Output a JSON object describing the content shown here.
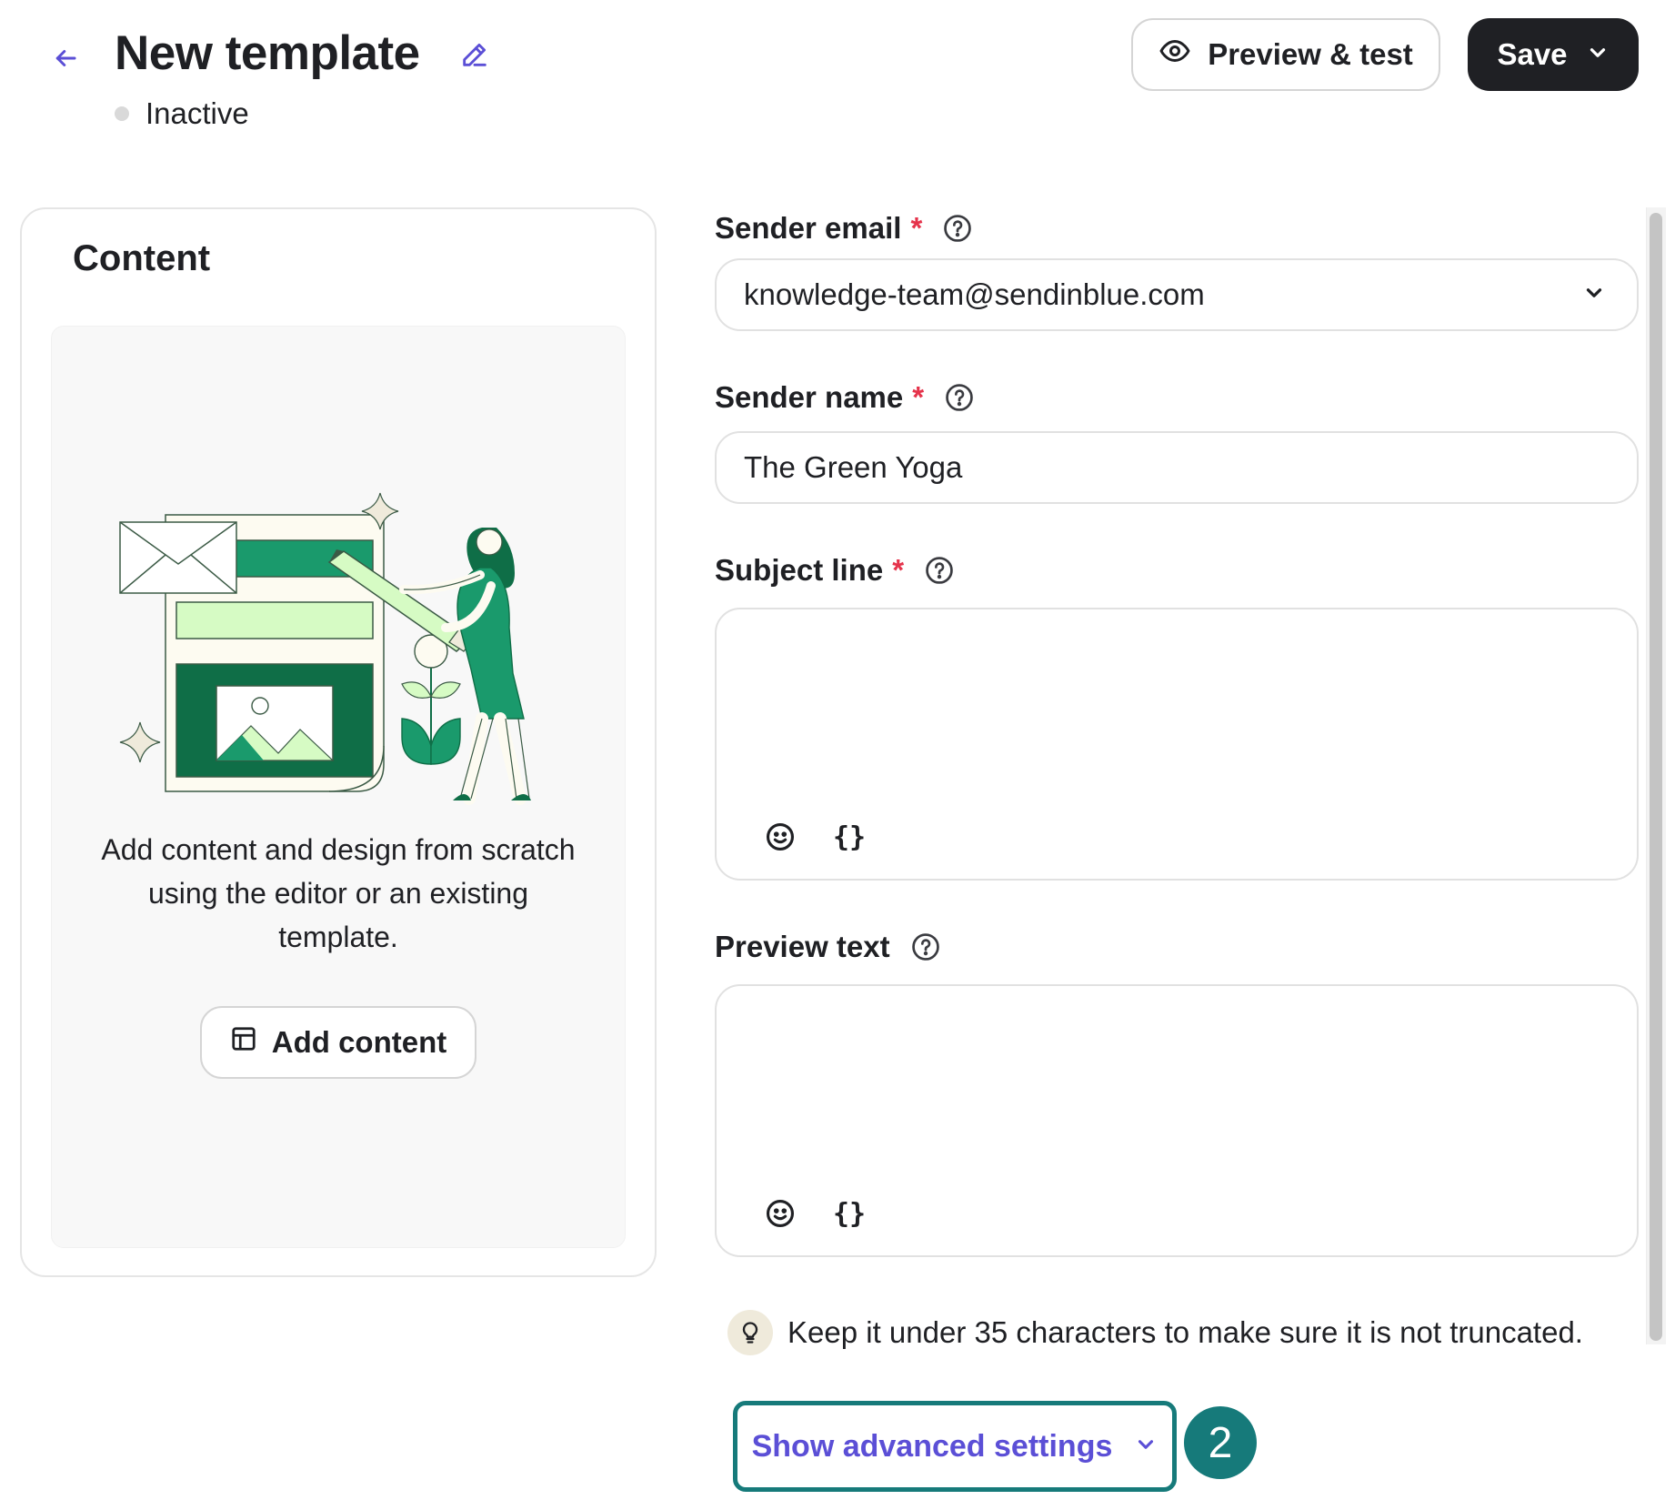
{
  "header": {
    "title": "New template",
    "status": "Inactive",
    "preview_label": "Preview & test",
    "save_label": "Save"
  },
  "content": {
    "heading": "Content",
    "description": "Add content and design from scratch using the editor or an existing template.",
    "add_label": "Add content"
  },
  "form": {
    "sender_email": {
      "label": "Sender email",
      "value": "knowledge-team@sendinblue.com"
    },
    "sender_name": {
      "label": "Sender name",
      "value": "The Green Yoga"
    },
    "subject_line": {
      "label": "Subject line",
      "value": ""
    },
    "preview_text": {
      "label": "Preview text",
      "value": ""
    },
    "required_mark": "*",
    "variable_tool": "{}"
  },
  "tip": "Keep it under 35 characters to make sure it is not truncated.",
  "advanced": {
    "label": "Show advanced settings"
  },
  "step_badge": "2",
  "colors": {
    "accent": "#5b4fd6",
    "dark_button": "#1f2024",
    "required": "#e5334b",
    "highlight": "#167a7a",
    "illustration_green": "#1a9a6c",
    "illustration_dark": "#0f6e47",
    "illustration_light": "#d6fbc4"
  },
  "icons": {
    "back": "arrow-left-icon",
    "edit": "pencil-icon",
    "preview": "eye-icon",
    "save_dropdown": "chevron-down-icon",
    "help": "question-circle-icon",
    "add_content": "layout-icon",
    "emoji": "smiley-icon",
    "tip": "lightbulb-icon"
  }
}
